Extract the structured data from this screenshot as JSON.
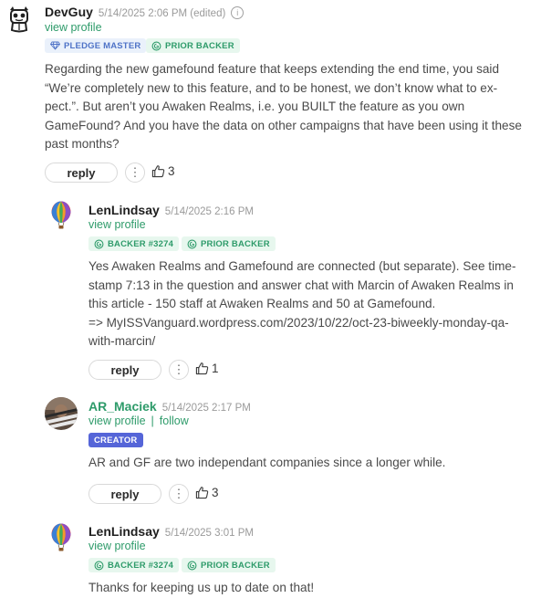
{
  "comments": [
    {
      "author": "DevGuy",
      "date": "5/14/2025 2:06 PM (edited)",
      "view_profile": "view profile",
      "badges": [
        "PLEDGE MASTER",
        "PRIOR BACKER"
      ],
      "text": "Regarding the new gamefound feature that keeps extending the end time, you said “We’re completely new to this feature, and to be honest, we don’t know what to ex-pect.”. But aren’t you Awaken Realms, i.e. you BUILT the feature as you own GameFound? And you have the data on other campaigns that have been using it these past months?",
      "text_lines": [
        "Regarding the new gamefound feature that keeps extending the end time, you said",
        "“We’re completely new to this feature, and to be honest, we don’t know what to ex-",
        "pect.”. But aren’t you Awaken Realms, i.e. you BUILT the feature as you own",
        "GameFound? And you have the data on other campaigns that have been using it these",
        "past months?"
      ],
      "reply_label": "reply",
      "likes": "3"
    },
    {
      "author": "LenLindsay",
      "date": "5/14/2025 2:16 PM",
      "view_profile": "view profile",
      "badges": [
        "BACKER #3274",
        "PRIOR BACKER"
      ],
      "text_lines": [
        "Yes Awaken Realms and Gamefound are connected (but separate). See time-",
        "stamp 7:13 in the question and answer chat with Marcin of Awaken Realms in",
        "this article - 150 staff at Awaken Realms and 50 at Gamefound.",
        "=> MyISSVanguard.wordpress.com/2023/10/22/oct-23-biweekly-monday-qa-",
        "with-marcin/"
      ],
      "reply_label": "reply",
      "likes": "1"
    },
    {
      "author": "AR_Maciek",
      "date": "5/14/2025 2:17 PM",
      "view_profile": "view profile",
      "follow": "follow",
      "badges": [
        "CREATOR"
      ],
      "text_lines": [
        "AR and GF are two independant companies since a longer while."
      ],
      "reply_label": "reply",
      "likes": "3"
    },
    {
      "author": "LenLindsay",
      "date": "5/14/2025 3:01 PM",
      "view_profile": "view profile",
      "badges": [
        "BACKER #3274",
        "PRIOR BACKER"
      ],
      "text_lines": [
        "Thanks for keeping us up to date on that!"
      ]
    }
  ],
  "icons": {
    "avatar_devguy": "robot-mascot-avatar",
    "avatar_len": "hot-air-balloon-avatar",
    "avatar_maciek": "photo-avatar",
    "info": "info-icon",
    "pledge_master": "diamond-icon",
    "prior_backer": "gamefound-g-icon",
    "more": "more-dots-icon",
    "like": "thumbs-up-icon"
  },
  "colors": {
    "author_link": "#2e9b6a",
    "badge_green_bg": "#e7f7ee",
    "badge_blue_bg": "#eaf1fb",
    "creator_bg": "#5565d8"
  }
}
